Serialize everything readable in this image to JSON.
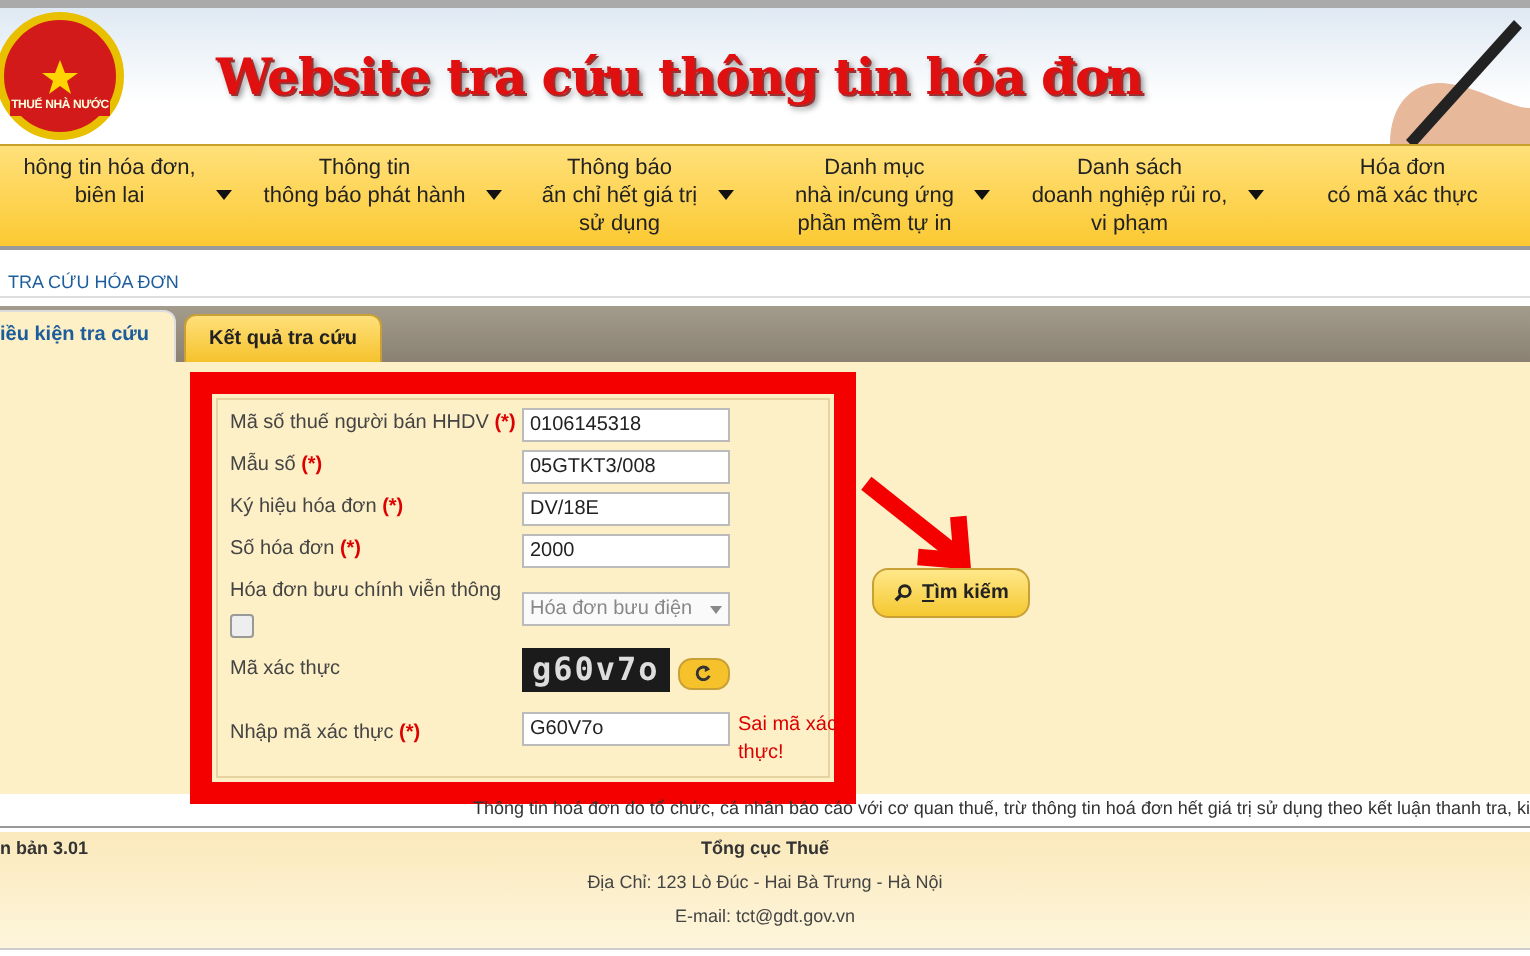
{
  "header": {
    "title": "Website tra cứu thông tin hóa đơn",
    "emblem_text": "THUẾ NHÀ NƯỚC"
  },
  "nav": [
    {
      "lines": [
        "hông tin hóa đơn,",
        "biên lai"
      ],
      "dropdown": true
    },
    {
      "lines": [
        "Thông tin",
        "thông báo phát hành"
      ],
      "dropdown": true
    },
    {
      "lines": [
        "Thông báo",
        "ấn chỉ hết giá trị",
        "sử dụng"
      ],
      "dropdown": true
    },
    {
      "lines": [
        "Danh mục",
        "nhà in/cung ứng",
        "phần mềm tự in"
      ],
      "dropdown": true
    },
    {
      "lines": [
        "Danh sách",
        "doanh nghiệp rủi ro,",
        "vi phạm"
      ],
      "dropdown": true
    },
    {
      "lines": [
        "Hóa đơn",
        "có mã xác thực"
      ],
      "dropdown": false
    }
  ],
  "breadcrumb": "TRA CỨU HÓA ĐƠN",
  "tabs": [
    {
      "label": "iều kiện tra cứu",
      "selected": true
    },
    {
      "label": "Kết quả tra cứu",
      "selected": false
    }
  ],
  "form": {
    "fields": [
      {
        "kind": "text",
        "label": "Mã số thuế người bán HHDV",
        "marker": "(*)",
        "value": "0106145318"
      },
      {
        "kind": "text",
        "label": "Mẫu số",
        "marker": "(*)",
        "value": "05GTKT3/008"
      },
      {
        "kind": "text",
        "label": "Ký hiệu hóa đơn",
        "marker": "(*)",
        "value": "DV/18E"
      },
      {
        "kind": "text",
        "label": "Số hóa đơn",
        "marker": "(*)",
        "value": "2000"
      },
      {
        "kind": "check-select",
        "label": "Hóa đơn bưu chính viễn thông",
        "checked": false,
        "value": "Hóa đơn bưu điện",
        "disabled": true
      },
      {
        "kind": "captcha",
        "label": "Mã xác thực",
        "captcha": "g60v7o"
      },
      {
        "kind": "text",
        "label": "Nhập mã xác thực",
        "marker": "(*)",
        "value": "G60V7o",
        "error": "Sai mã xác thực!"
      }
    ]
  },
  "search_button": "Tìm kiếm",
  "notice": "Thông tin hoá đơn do tổ chức, cá nhân báo cáo với cơ quan thuế, trừ thông tin hoá đơn hết giá trị sử dụng theo kết luận thanh tra, ki",
  "footer": {
    "version": "n bản 3.01",
    "org": "Tổng cục Thuế",
    "address": "Địa Chỉ: 123 Lò Đúc - Hai Bà Trưng - Hà Nội",
    "email": "E-mail: tct@gdt.gov.vn"
  }
}
